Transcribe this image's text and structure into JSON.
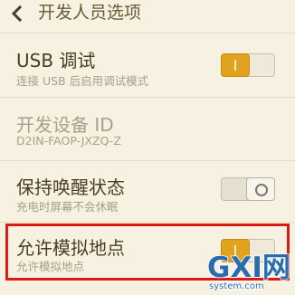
{
  "header": {
    "title": "开发人员选项",
    "back_icon": "chevron-left-icon"
  },
  "settings": [
    {
      "title": "USB 调试",
      "subtitle": "连接 USB 后启用调试模式",
      "toggle": "on"
    },
    {
      "title": "开发设备 ID",
      "subtitle": "D2IN-FAOP-JXZQ-Z",
      "disabled": true
    },
    {
      "title": "保持唤醒状态",
      "subtitle": "充电时屏幕不会休眠",
      "toggle": "off"
    },
    {
      "title": "允许模拟地点",
      "subtitle": "允许模拟地点",
      "toggle": "on",
      "highlighted": true
    }
  ],
  "watermark": {
    "logo": "GXI网",
    "domain": "system.com"
  },
  "colors": {
    "background": "#f6f1e1",
    "accent": "#e1a21d",
    "highlight_border": "#dc1b17",
    "watermark": "#2a6cb0"
  }
}
